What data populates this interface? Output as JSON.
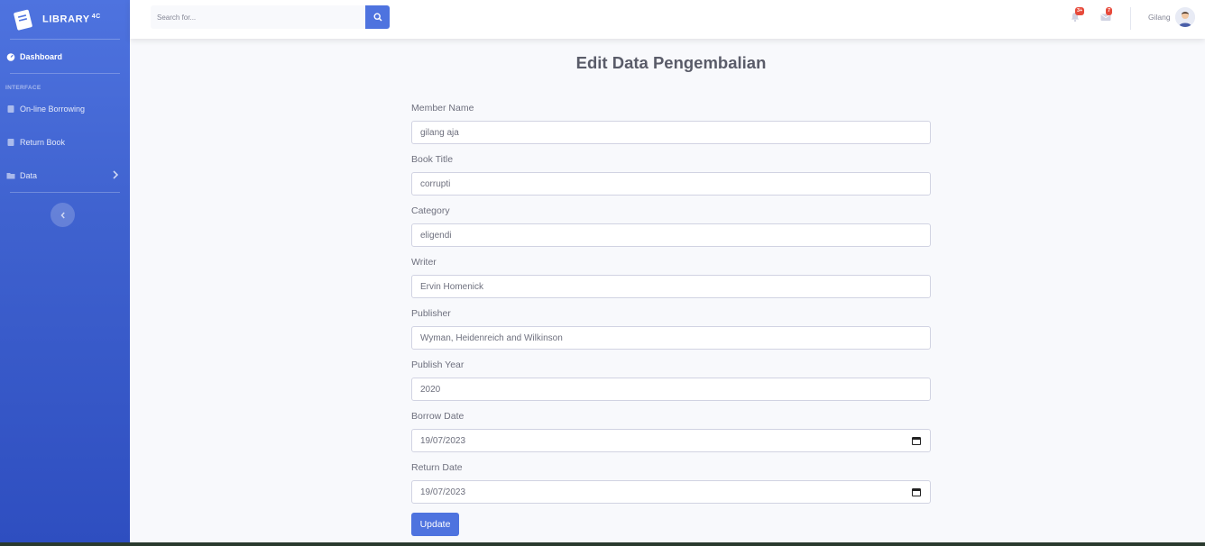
{
  "brand": {
    "name": "LIBRARY",
    "sup": "4C"
  },
  "sidebar": {
    "dashboard": "Dashboard",
    "heading": "INTERFACE",
    "items": [
      {
        "label": "On-line Borrowing",
        "icon": "book-icon"
      },
      {
        "label": "Return Book",
        "icon": "book-icon"
      },
      {
        "label": "Data",
        "icon": "folder-icon"
      }
    ]
  },
  "topbar": {
    "search_placeholder": "Search for...",
    "alerts_badge": "3+",
    "messages_badge": "7",
    "user_name": "Gilang"
  },
  "page": {
    "title": "Edit Data Pengembalian"
  },
  "form": {
    "fields": [
      {
        "label": "Member Name",
        "value": "gilang aja"
      },
      {
        "label": "Book Title",
        "value": "corrupti"
      },
      {
        "label": "Category",
        "value": "eligendi"
      },
      {
        "label": "Writer",
        "value": "Ervin Homenick"
      },
      {
        "label": "Publisher",
        "value": "Wyman, Heidenreich and Wilkinson"
      },
      {
        "label": "Publish Year",
        "value": "2020"
      },
      {
        "label": "Borrow Date",
        "value": "19/07/2023"
      },
      {
        "label": "Return Date",
        "value": "19/07/2023"
      }
    ],
    "submit": "Update"
  },
  "colors": {
    "primary": "#4e73df",
    "danger": "#e74a3b",
    "text": "#5a5c69"
  }
}
